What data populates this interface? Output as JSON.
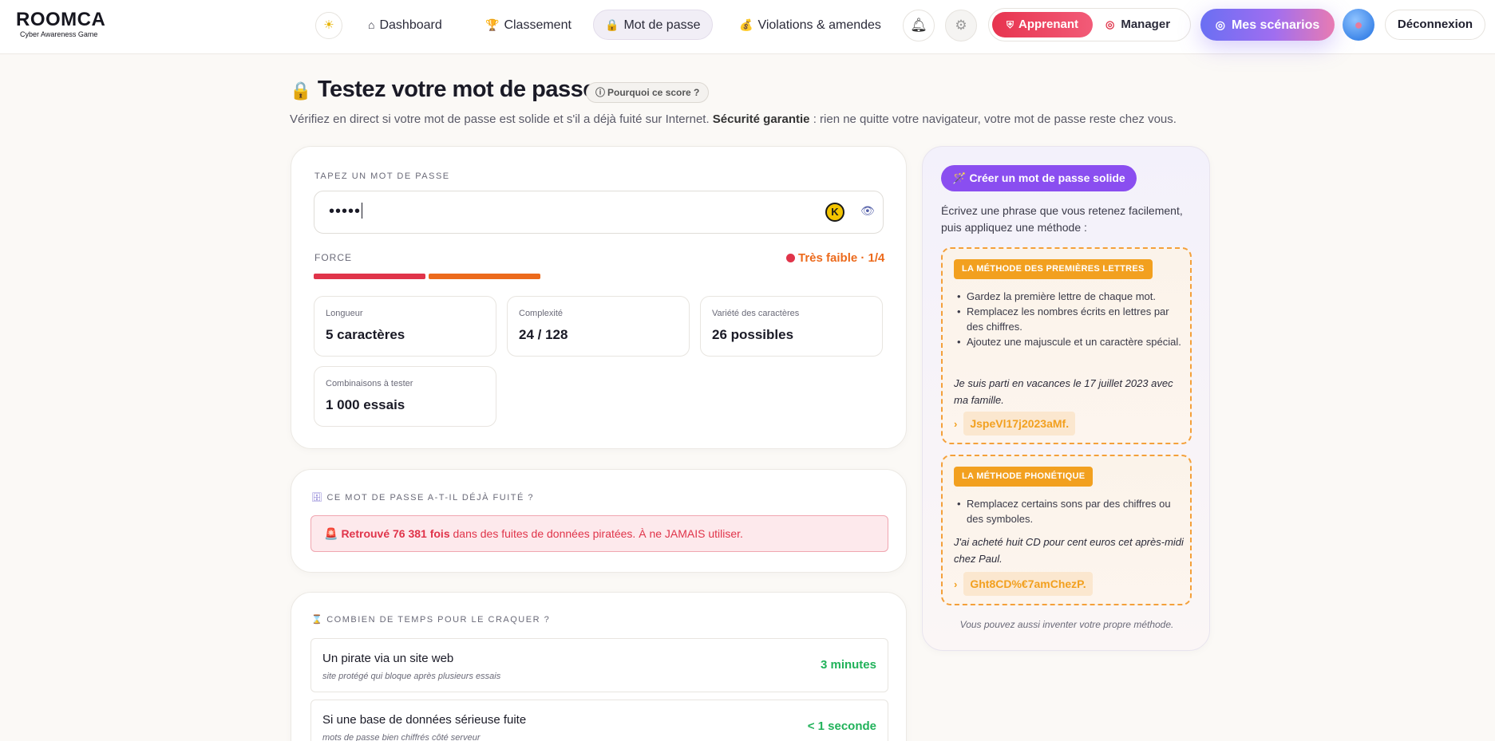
{
  "nav": {
    "logo": "ROOMCA",
    "logo_sub": "Cyber Awareness Game",
    "items": [
      {
        "label": "Dashboard"
      },
      {
        "label": "Classement"
      },
      {
        "label": "Mot de passe"
      },
      {
        "label": "Violations & amendes"
      }
    ],
    "roles": {
      "apprenant": "Apprenant",
      "manager": "Manager"
    },
    "scenarios": "Mes scénarios",
    "logout": "Déconnexion"
  },
  "header": {
    "title": "Testez votre mot de passe",
    "why_badge": "Pourquoi ce score ?",
    "subtitle_pre": "Vérifiez en direct si votre mot de passe est solide et s'il a déjà fuité sur Internet.",
    "subtitle_bold": "Sécurité garantie",
    "subtitle_post": ": rien ne quitte votre navigateur, votre mot de passe reste chez vous."
  },
  "password": {
    "label": "TAPEZ UN MOT DE PASSE",
    "value": "•••••",
    "force_label": "FORCE",
    "force_status": "Très faible · 1/4",
    "force_level": 2,
    "force_total": 6,
    "stats": [
      {
        "label": "Longueur",
        "value": "5 caractères"
      },
      {
        "label": "Complexité",
        "value": "24 / 128"
      },
      {
        "label": "Variété des caractères",
        "value": "26 possibles"
      },
      {
        "label": "Combinaisons à tester",
        "value": "1 000 essais"
      }
    ]
  },
  "leak": {
    "title": "CE MOT DE PASSE A-T-IL DÉJÀ FUITÉ ?",
    "found": "Retrouvé 76 381 fois",
    "rest": "dans des fuites de données piratées. À ne JAMAIS utiliser."
  },
  "crack": {
    "title": "COMBIEN DE TEMPS POUR LE CRAQUER ?",
    "rows": [
      {
        "title": "Un pirate via un site web",
        "sub": "site protégé qui bloque après plusieurs essais",
        "time": "3 minutes"
      },
      {
        "title": "Si une base de données sérieuse fuite",
        "sub": "mots de passe bien chiffrés côté serveur",
        "time": "< 1 seconde"
      }
    ]
  },
  "side": {
    "button": "Créer un mot de passe solide",
    "intro": "Écrivez une phrase que vous retenez facilement, puis appliquez une méthode :",
    "methods": [
      {
        "tag": "LA MÉTHODE DES PREMIÈRES LETTRES",
        "bullets": [
          "Gardez la première lettre de chaque mot.",
          "Remplacez les nombres écrits en lettres par des chiffres.",
          "Ajoutez une majuscule et un caractère spécial."
        ],
        "example": "Je suis parti en vacances le 17 juillet 2023 avec ma famille.",
        "result": "JspeVl17j2023aMf."
      },
      {
        "tag": "LA MÉTHODE PHONÉTIQUE",
        "bullets": [
          "Remplacez certains sons par des chiffres ou des symboles."
        ],
        "example": "J'ai acheté huit CD pour cent euros cet après-midi chez Paul.",
        "result": "Ght8CD%€7amChezP."
      }
    ],
    "footer": "Vous pouvez aussi inventer votre propre méthode."
  },
  "colors": {
    "accent_red": "#e0344a",
    "accent_orange": "#ec6a1c",
    "accent_green": "#21b25a",
    "accent_purple": "#8a4ef0",
    "method_orange": "#f2a01f"
  }
}
